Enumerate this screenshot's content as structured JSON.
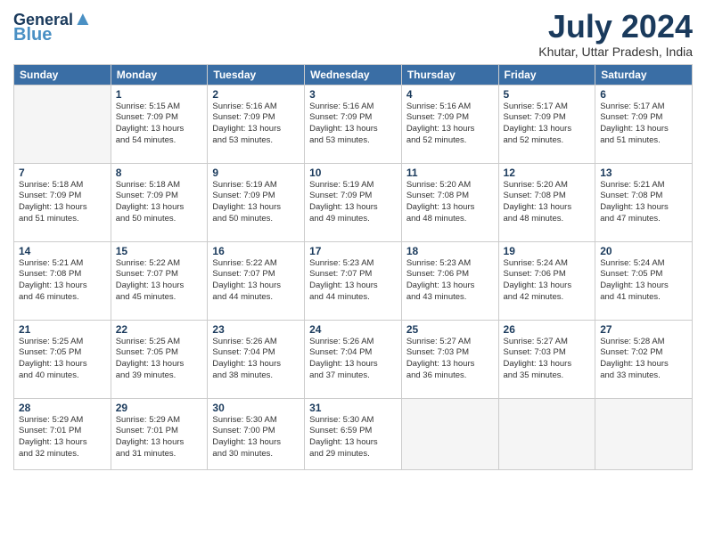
{
  "logo": {
    "line1": "General",
    "line2": "Blue",
    "bird": "🐦"
  },
  "title": "July 2024",
  "location": "Khutar, Uttar Pradesh, India",
  "headers": [
    "Sunday",
    "Monday",
    "Tuesday",
    "Wednesday",
    "Thursday",
    "Friday",
    "Saturday"
  ],
  "weeks": [
    [
      {
        "day": "",
        "info": ""
      },
      {
        "day": "1",
        "info": "Sunrise: 5:15 AM\nSunset: 7:09 PM\nDaylight: 13 hours\nand 54 minutes."
      },
      {
        "day": "2",
        "info": "Sunrise: 5:16 AM\nSunset: 7:09 PM\nDaylight: 13 hours\nand 53 minutes."
      },
      {
        "day": "3",
        "info": "Sunrise: 5:16 AM\nSunset: 7:09 PM\nDaylight: 13 hours\nand 53 minutes."
      },
      {
        "day": "4",
        "info": "Sunrise: 5:16 AM\nSunset: 7:09 PM\nDaylight: 13 hours\nand 52 minutes."
      },
      {
        "day": "5",
        "info": "Sunrise: 5:17 AM\nSunset: 7:09 PM\nDaylight: 13 hours\nand 52 minutes."
      },
      {
        "day": "6",
        "info": "Sunrise: 5:17 AM\nSunset: 7:09 PM\nDaylight: 13 hours\nand 51 minutes."
      }
    ],
    [
      {
        "day": "7",
        "info": "Sunrise: 5:18 AM\nSunset: 7:09 PM\nDaylight: 13 hours\nand 51 minutes."
      },
      {
        "day": "8",
        "info": "Sunrise: 5:18 AM\nSunset: 7:09 PM\nDaylight: 13 hours\nand 50 minutes."
      },
      {
        "day": "9",
        "info": "Sunrise: 5:19 AM\nSunset: 7:09 PM\nDaylight: 13 hours\nand 50 minutes."
      },
      {
        "day": "10",
        "info": "Sunrise: 5:19 AM\nSunset: 7:09 PM\nDaylight: 13 hours\nand 49 minutes."
      },
      {
        "day": "11",
        "info": "Sunrise: 5:20 AM\nSunset: 7:08 PM\nDaylight: 13 hours\nand 48 minutes."
      },
      {
        "day": "12",
        "info": "Sunrise: 5:20 AM\nSunset: 7:08 PM\nDaylight: 13 hours\nand 48 minutes."
      },
      {
        "day": "13",
        "info": "Sunrise: 5:21 AM\nSunset: 7:08 PM\nDaylight: 13 hours\nand 47 minutes."
      }
    ],
    [
      {
        "day": "14",
        "info": "Sunrise: 5:21 AM\nSunset: 7:08 PM\nDaylight: 13 hours\nand 46 minutes."
      },
      {
        "day": "15",
        "info": "Sunrise: 5:22 AM\nSunset: 7:07 PM\nDaylight: 13 hours\nand 45 minutes."
      },
      {
        "day": "16",
        "info": "Sunrise: 5:22 AM\nSunset: 7:07 PM\nDaylight: 13 hours\nand 44 minutes."
      },
      {
        "day": "17",
        "info": "Sunrise: 5:23 AM\nSunset: 7:07 PM\nDaylight: 13 hours\nand 44 minutes."
      },
      {
        "day": "18",
        "info": "Sunrise: 5:23 AM\nSunset: 7:06 PM\nDaylight: 13 hours\nand 43 minutes."
      },
      {
        "day": "19",
        "info": "Sunrise: 5:24 AM\nSunset: 7:06 PM\nDaylight: 13 hours\nand 42 minutes."
      },
      {
        "day": "20",
        "info": "Sunrise: 5:24 AM\nSunset: 7:05 PM\nDaylight: 13 hours\nand 41 minutes."
      }
    ],
    [
      {
        "day": "21",
        "info": "Sunrise: 5:25 AM\nSunset: 7:05 PM\nDaylight: 13 hours\nand 40 minutes."
      },
      {
        "day": "22",
        "info": "Sunrise: 5:25 AM\nSunset: 7:05 PM\nDaylight: 13 hours\nand 39 minutes."
      },
      {
        "day": "23",
        "info": "Sunrise: 5:26 AM\nSunset: 7:04 PM\nDaylight: 13 hours\nand 38 minutes."
      },
      {
        "day": "24",
        "info": "Sunrise: 5:26 AM\nSunset: 7:04 PM\nDaylight: 13 hours\nand 37 minutes."
      },
      {
        "day": "25",
        "info": "Sunrise: 5:27 AM\nSunset: 7:03 PM\nDaylight: 13 hours\nand 36 minutes."
      },
      {
        "day": "26",
        "info": "Sunrise: 5:27 AM\nSunset: 7:03 PM\nDaylight: 13 hours\nand 35 minutes."
      },
      {
        "day": "27",
        "info": "Sunrise: 5:28 AM\nSunset: 7:02 PM\nDaylight: 13 hours\nand 33 minutes."
      }
    ],
    [
      {
        "day": "28",
        "info": "Sunrise: 5:29 AM\nSunset: 7:01 PM\nDaylight: 13 hours\nand 32 minutes."
      },
      {
        "day": "29",
        "info": "Sunrise: 5:29 AM\nSunset: 7:01 PM\nDaylight: 13 hours\nand 31 minutes."
      },
      {
        "day": "30",
        "info": "Sunrise: 5:30 AM\nSunset: 7:00 PM\nDaylight: 13 hours\nand 30 minutes."
      },
      {
        "day": "31",
        "info": "Sunrise: 5:30 AM\nSunset: 6:59 PM\nDaylight: 13 hours\nand 29 minutes."
      },
      {
        "day": "",
        "info": ""
      },
      {
        "day": "",
        "info": ""
      },
      {
        "day": "",
        "info": ""
      }
    ]
  ]
}
